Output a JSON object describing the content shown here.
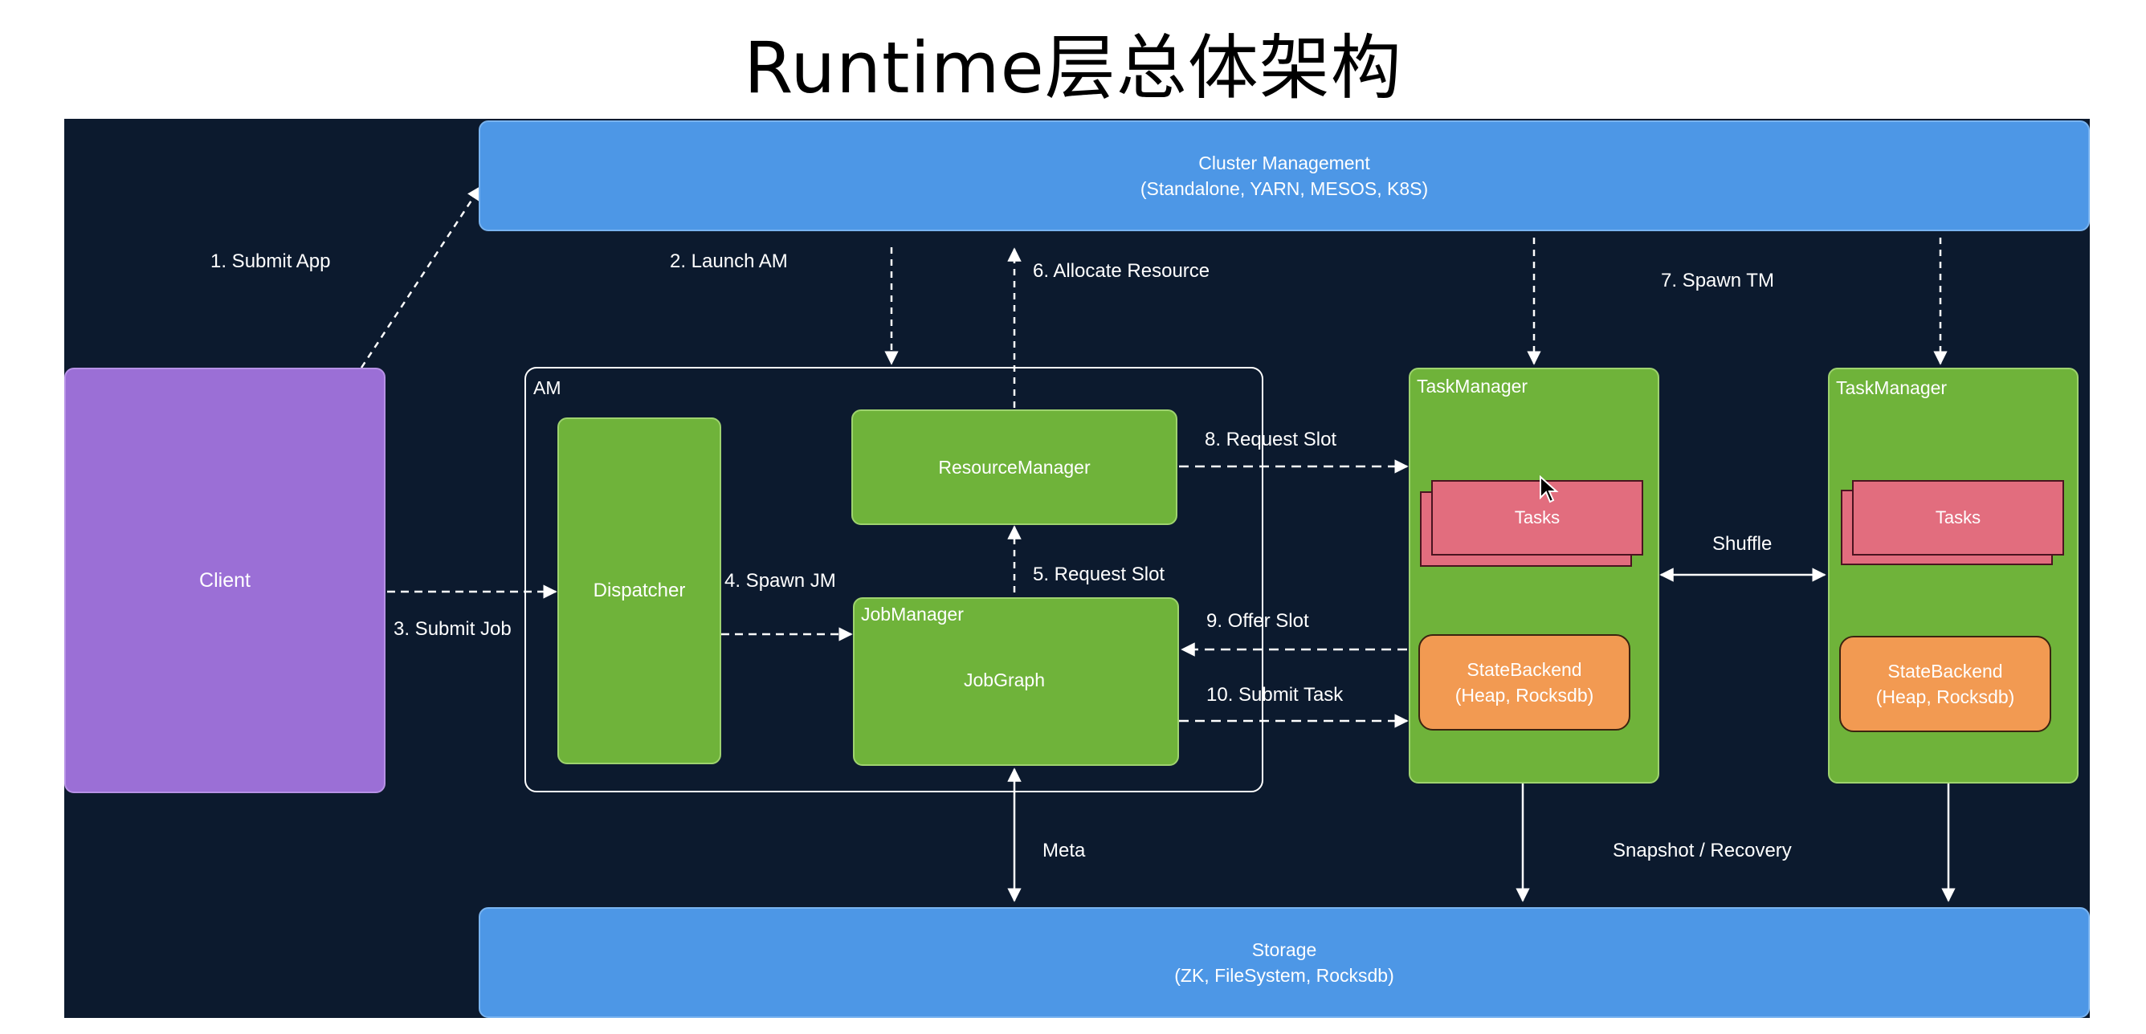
{
  "title": "Runtime层总体架构",
  "nodes": {
    "cluster": {
      "line1": "Cluster Management",
      "line2": "(Standalone, YARN, MESOS, K8S)"
    },
    "storage": {
      "line1": "Storage",
      "line2": "(ZK, FileSystem, Rocksdb)"
    },
    "client": "Client",
    "am": "AM",
    "dispatcher": "Dispatcher",
    "resource_manager": "ResourceManager",
    "job_manager": "JobManager",
    "job_graph": "JobGraph",
    "task_manager_1": "TaskManager",
    "task_manager_2": "TaskManager",
    "tasks_1": "Tasks",
    "tasks_2": "Tasks",
    "state_backend_1": {
      "line1": "StateBackend",
      "line2": "(Heap, Rocksdb)"
    },
    "state_backend_2": {
      "line1": "StateBackend",
      "line2": "(Heap, Rocksdb)"
    }
  },
  "edges": {
    "submit_app": "1. Submit App",
    "launch_am": "2. Launch AM",
    "submit_job": "3. Submit Job",
    "spawn_jm": "4. Spawn JM",
    "request_slot_5": "5. Request Slot",
    "allocate_resource": "6. Allocate Resource",
    "spawn_tm": "7. Spawn TM",
    "request_slot_8": "8. Request Slot",
    "offer_slot": "9. Offer Slot",
    "submit_task": "10. Submit Task",
    "shuffle": "Shuffle",
    "meta": "Meta",
    "snapshot": "Snapshot / Recovery"
  },
  "colors": {
    "background": "#0c1a2e",
    "blue": "#4d97e6",
    "green": "#6fb33a",
    "purple": "#9b6fd6",
    "pink": "#e26d7e",
    "orange": "#f29a52"
  }
}
